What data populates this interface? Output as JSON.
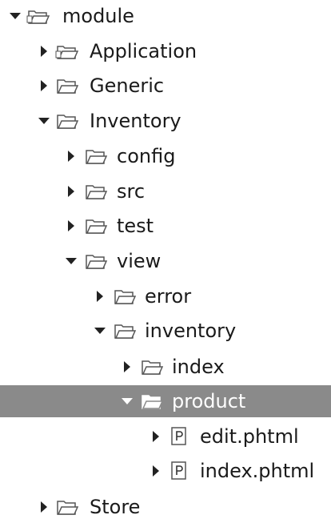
{
  "tree": {
    "root": {
      "label": "module",
      "icon": "package-folder-icon",
      "expanded": true
    },
    "application": {
      "label": "Application",
      "icon": "package-folder-icon",
      "expanded": false
    },
    "generic": {
      "label": "Generic",
      "icon": "folder-icon",
      "expanded": false
    },
    "inventory": {
      "label": "Inventory",
      "icon": "folder-icon",
      "expanded": true
    },
    "config": {
      "label": "config",
      "icon": "folder-icon",
      "expanded": false
    },
    "src": {
      "label": "src",
      "icon": "folder-icon",
      "expanded": false
    },
    "test": {
      "label": "test",
      "icon": "folder-icon",
      "expanded": false
    },
    "view": {
      "label": "view",
      "icon": "folder-icon",
      "expanded": true
    },
    "error": {
      "label": "error",
      "icon": "folder-icon",
      "expanded": false
    },
    "inventory_view": {
      "label": "inventory",
      "icon": "folder-icon",
      "expanded": true
    },
    "index": {
      "label": "index",
      "icon": "folder-icon",
      "expanded": false
    },
    "product": {
      "label": "product",
      "icon": "folder-icon",
      "expanded": true,
      "selected": true
    },
    "edit_phtml": {
      "label": "edit.phtml",
      "icon": "php-file-icon"
    },
    "index_phtml": {
      "label": "index.phtml",
      "icon": "php-file-icon"
    },
    "store": {
      "label": "Store",
      "icon": "folder-icon",
      "expanded": false
    }
  },
  "colors": {
    "selection": "#8a8a8a",
    "text": "#1a1a1a",
    "selected_text": "#ffffff"
  }
}
